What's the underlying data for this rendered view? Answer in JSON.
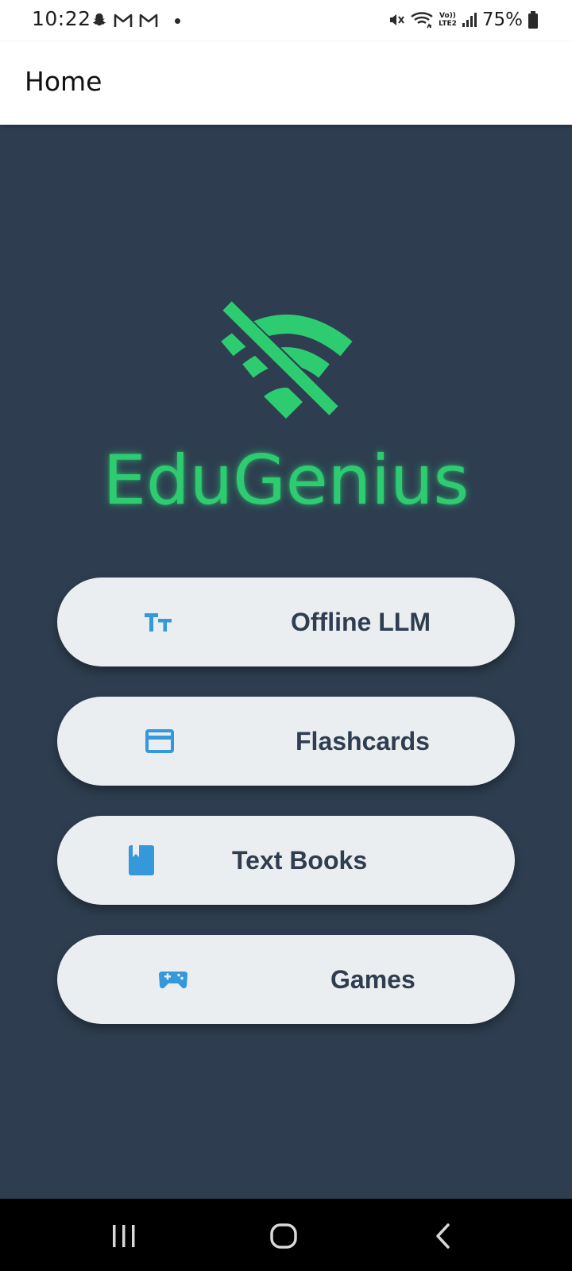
{
  "status_bar": {
    "time": "10:22",
    "left_icons": [
      "snapchat-icon",
      "gmail-icon",
      "gmail-icon",
      "notification-dot"
    ],
    "right_icons": [
      "mute-icon",
      "wifi-icon",
      "volte-icon",
      "signal-icon",
      "battery-icon"
    ],
    "volte_line1": "Vo))",
    "volte_line2": "LTE2",
    "battery_percent": "75%"
  },
  "app_bar": {
    "title": "Home"
  },
  "brand": {
    "name": "EduGenius",
    "icon": "wifi-off-icon",
    "color": "#2ecc71"
  },
  "menu": {
    "items": [
      {
        "label": "Offline LLM",
        "icon": "text-fields-icon"
      },
      {
        "label": "Flashcards",
        "icon": "credit-card-icon"
      },
      {
        "label": "Text Books",
        "icon": "book-icon"
      },
      {
        "label": "Games",
        "icon": "gamepad-icon"
      }
    ]
  },
  "nav_bar": {
    "items": [
      "recent-apps-icon",
      "home-icon",
      "back-icon"
    ]
  },
  "colors": {
    "background": "#2e3e50",
    "button_bg": "#ebeef0",
    "button_text": "#2e3e50",
    "icon_blue": "#3498db",
    "accent_green": "#2ecc71"
  }
}
